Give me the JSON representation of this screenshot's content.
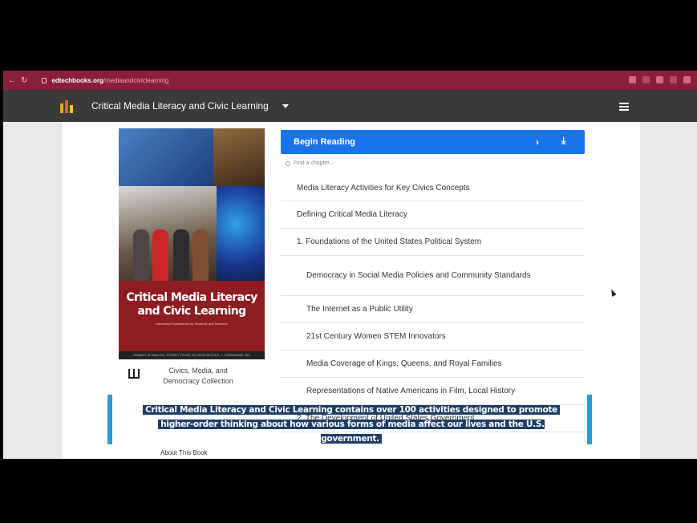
{
  "browser": {
    "url_domain": "edtechbooks.org",
    "url_path": "/mediaandciviclearning"
  },
  "site": {
    "title": "Critical Media Literacy and Civic Learning"
  },
  "cover": {
    "title_line1": "Critical Media Literacy",
    "title_line2": "and Civic Learning",
    "subtitle": "Interactive Explorations for Students and Teachers",
    "authors": "ROBERT W. MALONI, TORREY TRUST, ALLISON BUTLER, J. CARRADINE, EIS"
  },
  "collection": {
    "label": "Civics, Media, and Democracy Collection"
  },
  "about_label": "About This Book",
  "panel": {
    "begin_label": "Begin Reading",
    "chevron": "›",
    "download_glyph": "⤓",
    "find_placeholder": "Find a chapter...",
    "chapters": [
      "Media Literacy Activities for Key Civics Concepts",
      "Defining Critical Media Literacy",
      "1. Foundations of the United States Political System",
      "Democracy in Social Media Policies and Community Standards",
      "The Internet as a Public Utility",
      "21st Century Women STEM Innovators",
      "Media Coverage of Kings, Queens, and Royal Families",
      "Representations of Native Americans in Film, Local History",
      "2. The Development of United States Government"
    ]
  },
  "caption": {
    "line1": "Critical Media Literacy and Civic Learning contains over 100 activities designed to promote",
    "line2": "higher-order thinking about how various forms of media affect our lives and the U.S. government."
  },
  "colors": {
    "browser_bar": "#8a1f3b",
    "site_header": "#3a3a3a",
    "begin_button": "#1a73e8",
    "cover_band": "#8e1d22",
    "caption_border": "#2a9bd1",
    "caption_bg": "#1f3e66"
  }
}
